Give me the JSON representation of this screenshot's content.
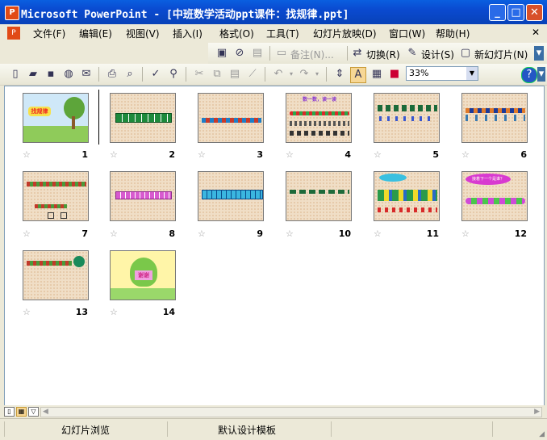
{
  "window": {
    "title": "Microsoft PowerPoint - [中班数学活动ppt课件：找规律.ppt]",
    "app_icon": "P"
  },
  "menubar": {
    "items": [
      "文件(F)",
      "编辑(E)",
      "视图(V)",
      "插入(I)",
      "格式(O)",
      "工具(T)",
      "幻灯片放映(D)",
      "窗口(W)",
      "帮助(H)"
    ],
    "close_glyph": "✕"
  },
  "toolbar_review": {
    "comment_label": "备注(N)...",
    "transition_label": "切换(R)",
    "design_label": "设计(S)",
    "new_slide_label": "新幻灯片(N)"
  },
  "toolbar_standard": {
    "zoom_value": "33%"
  },
  "slides": [
    {
      "number": "1",
      "title_text": "找规律",
      "thanks_text": ""
    },
    {
      "number": "2"
    },
    {
      "number": "3"
    },
    {
      "number": "4",
      "title_text": "数一数，读一读"
    },
    {
      "number": "5"
    },
    {
      "number": "6"
    },
    {
      "number": "7"
    },
    {
      "number": "8"
    },
    {
      "number": "9"
    },
    {
      "number": "10"
    },
    {
      "number": "11"
    },
    {
      "number": "12",
      "title_text": "接着下一个是谁？"
    },
    {
      "number": "13"
    },
    {
      "number": "14",
      "title_text": "谢谢"
    }
  ],
  "statusbar": {
    "view_name": "幻灯片浏览",
    "template_name": "默认设计模板"
  },
  "colors": {
    "title_blue": "#0A4AD0",
    "slide_bg": "#F0DEC6",
    "selection": "#000000"
  }
}
